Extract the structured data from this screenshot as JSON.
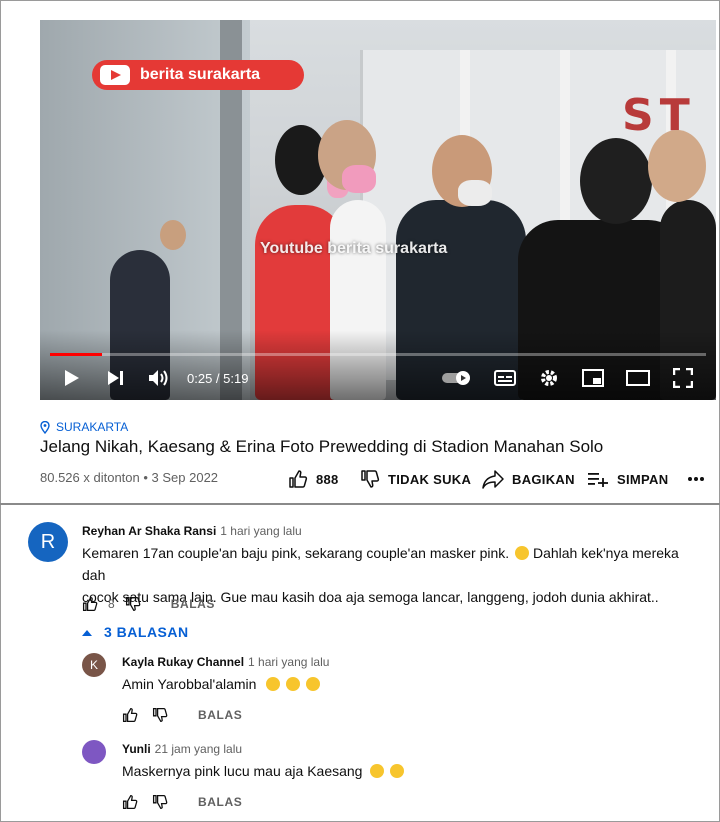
{
  "video": {
    "badge_text": "berita surakarta",
    "watermark": "Youtube berita surakarta",
    "sign_text": "ST",
    "time_display": "0:25 / 5:19",
    "progress_fraction": 0.08
  },
  "meta": {
    "location": "SURAKARTA",
    "title": "Jelang Nikah, Kaesang & Erina Foto Prewedding di Stadion Manahan Solo",
    "views_date": "80.526 x ditonton • 3 Sep 2022",
    "like_count": "888",
    "dislike_label": "TIDAK SUKA",
    "share_label": "BAGIKAN",
    "save_label": "SIMPAN"
  },
  "comments": [
    {
      "avatar_letter": "R",
      "avatar_color": "#1565c0",
      "author": "Reyhan Ar Shaka Ransi",
      "time": "1 hari yang lalu",
      "line1": "Kemaren 17an couple'an baju pink, sekarang couple'an masker pink.",
      "line2": "Dahlah kek'nya mereka dah",
      "line3": "cocok satu sama lain. Gue mau kasih doa aja semoga lancar, langgeng, jodoh dunia akhirat..",
      "likes": "8",
      "reply_label": "BALAS"
    }
  ],
  "replies_toggle": "3 BALASAN",
  "replies": [
    {
      "avatar_letter": "K",
      "avatar_color": "#795548",
      "author": "Kayla Rukay Channel",
      "time": "1 hari yang lalu",
      "text": "Amin Yarobbal'alamin",
      "reply_label": "BALAS"
    },
    {
      "avatar_letter": "",
      "avatar_color": "#7e57c2",
      "author": "Yunli",
      "time": "21 jam yang lalu",
      "text": "Maskernya pink lucu mau aja Kaesang",
      "reply_label": "BALAS"
    }
  ],
  "colors": {
    "accent_blue": "#065fd4",
    "youtube_red": "#ff0000"
  },
  "icons": [
    "location-pin-icon",
    "like-icon",
    "dislike-icon",
    "share-icon",
    "save-playlist-icon",
    "more-icon",
    "play-icon",
    "next-icon",
    "volume-icon",
    "autoplay-toggle-icon",
    "captions-icon",
    "settings-icon",
    "miniplayer-icon",
    "theater-icon",
    "fullscreen-icon",
    "chevron-up-icon"
  ]
}
